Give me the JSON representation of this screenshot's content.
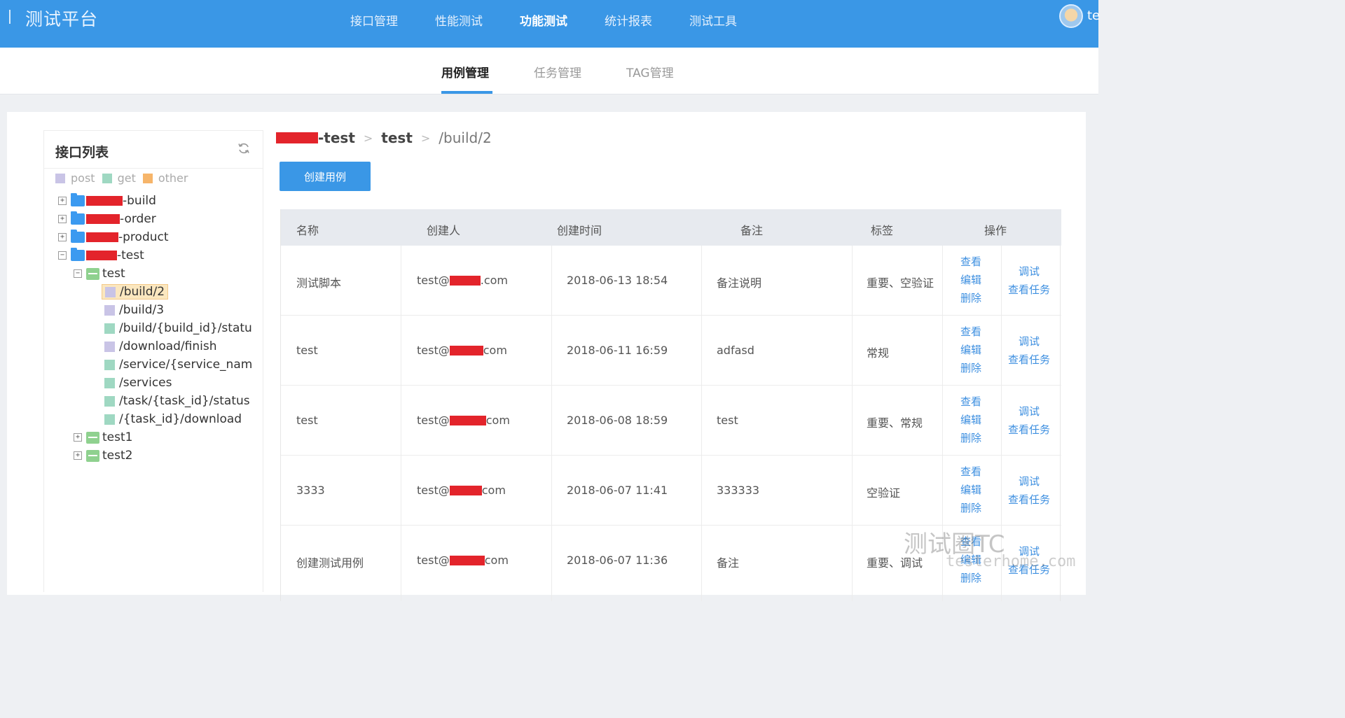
{
  "header": {
    "app_title": "测试平台",
    "user_name": "te",
    "nav": [
      "接口管理",
      "性能测试",
      "功能测试",
      "统计报表",
      "测试工具"
    ],
    "active_nav": 2
  },
  "subtabs": [
    "用例管理",
    "任务管理",
    "TAG管理"
  ],
  "sidebar": {
    "title": "接口列表",
    "legend": [
      {
        "label": "post",
        "color": "#c9c4e6"
      },
      {
        "label": "get",
        "color": "#9fd8c2"
      },
      {
        "label": "other",
        "color": "#f6b56a"
      }
    ],
    "tree": {
      "services": [
        {
          "suffix": "-build",
          "toggle": "+"
        },
        {
          "suffix": "-order",
          "toggle": "+"
        },
        {
          "suffix": "-product",
          "toggle": "+"
        },
        {
          "suffix": "-test",
          "toggle": "−"
        }
      ],
      "group_test": "test",
      "leaves": [
        {
          "label": "/build/2",
          "method": "post"
        },
        {
          "label": "/build/3",
          "method": "post"
        },
        {
          "label": "/build/{build_id}/statu",
          "method": "get"
        },
        {
          "label": "/download/finish",
          "method": "post"
        },
        {
          "label": "/service/{service_nam",
          "method": "get"
        },
        {
          "label": "/services",
          "method": "get"
        },
        {
          "label": "/task/{task_id}/status",
          "method": "get"
        },
        {
          "label": "/{task_id}/download",
          "method": "get"
        }
      ],
      "group_test1": "test1",
      "group_test2": "test2"
    }
  },
  "breadcrumb": {
    "service": "-test",
    "group": "test",
    "api": "/build/2",
    "separator": ">"
  },
  "create_button": "创建用例",
  "table": {
    "headers": [
      "名称",
      "创建人",
      "创建时间",
      "备注",
      "标签",
      "操作"
    ],
    "rows": [
      {
        "name": "测试脚本",
        "creator_prefix": "test@",
        "creator_suffix": ".com",
        "time": "2018-06-13 18:54",
        "note": "备注说明",
        "tags": "重要、空验证"
      },
      {
        "name": "test",
        "creator_prefix": "test@",
        "creator_suffix": "com",
        "time": "2018-06-11 16:59",
        "note": "adfasd",
        "tags": "常规"
      },
      {
        "name": "test",
        "creator_prefix": "test@",
        "creator_suffix": "com",
        "time": "2018-06-08 18:59",
        "note": "test",
        "tags": "重要、常规"
      },
      {
        "name": "3333",
        "creator_prefix": "test@",
        "creator_suffix": "com",
        "time": "2018-06-07 11:41",
        "note": "333333",
        "tags": "空验证"
      },
      {
        "name": "创建测试用例",
        "creator_prefix": "test@",
        "creator_suffix": "com",
        "time": "2018-06-07 11:36",
        "note": "备注",
        "tags": "重要、调试"
      }
    ],
    "actions": {
      "view": "查看",
      "edit": "编辑",
      "delete": "删除",
      "debug": "调试",
      "view_tasks": "查看任务"
    }
  },
  "watermark": {
    "main": "测试圈TC",
    "sub": "testerhome.com"
  },
  "colors": {
    "accent": "#3a97e6",
    "redaction": "#e3242b",
    "link": "#3d8fe0"
  }
}
